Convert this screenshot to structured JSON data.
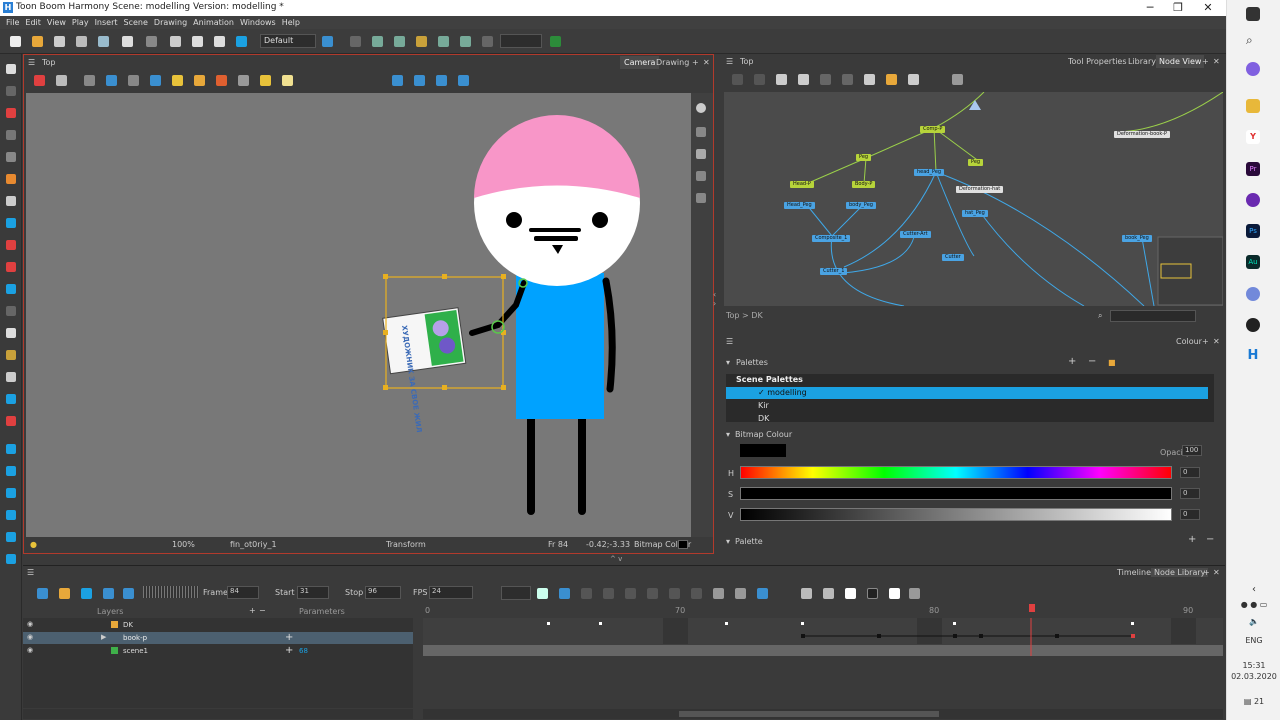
{
  "window": {
    "title": "Toon Boom Harmony Scene: modelling Version: modelling *",
    "minimize": "─",
    "restore": "❐",
    "close": "✕"
  },
  "menu": [
    "File",
    "Edit",
    "View",
    "Play",
    "Insert",
    "Scene",
    "Drawing",
    "Animation",
    "Windows",
    "Help"
  ],
  "toolbar": {
    "workspace_select": "Default"
  },
  "camera_panel": {
    "breadcrumb": "Top",
    "tabs": [
      "Camera",
      "Drawing"
    ],
    "status": {
      "zoom": "100%",
      "drawing_name": "fin_ot0riy_1",
      "tool": "Transform",
      "frame": "Fr 84",
      "coords": "-0.42;-3.33",
      "colour_mode": "Bitmap Colour"
    },
    "poster_text": "ХУДОЖНИК ЗА СВОЕ ЖИЛ"
  },
  "node_panel": {
    "breadcrumb": "Top",
    "tabs": [
      "Tool Properties",
      "Library",
      "Node View"
    ],
    "path": "Top  >  DK",
    "nodes": [
      {
        "label": "Comp-P",
        "kind": "g"
      },
      {
        "label": "Deformation-book-P",
        "kind": "w"
      },
      {
        "label": "Peg",
        "kind": "g"
      },
      {
        "label": "Peg",
        "kind": "g"
      },
      {
        "label": "Head-P",
        "kind": "g"
      },
      {
        "label": "Body-P",
        "kind": "g"
      },
      {
        "label": "head_Peg",
        "kind": "b"
      },
      {
        "label": "Deformation-hat",
        "kind": "w"
      },
      {
        "label": "Head_Peg",
        "kind": "b"
      },
      {
        "label": "body_Peg",
        "kind": "b"
      },
      {
        "label": "hat_Peg",
        "kind": "b"
      },
      {
        "label": "Composite_1",
        "kind": "b"
      },
      {
        "label": "Cutter-Art",
        "kind": "b"
      },
      {
        "label": "Cutter",
        "kind": "b"
      },
      {
        "label": "Cutter_1",
        "kind": "b"
      },
      {
        "label": "book_Peg",
        "kind": "b"
      }
    ]
  },
  "colour_panel": {
    "title": "Colour",
    "palettes_label": "Palettes",
    "scene_palettes_label": "Scene Palettes",
    "palettes": [
      {
        "name": "modelling",
        "selected": true
      },
      {
        "name": "Kir",
        "selected": false
      },
      {
        "name": "DK",
        "selected": false
      }
    ],
    "bitmap_colour_label": "Bitmap Colour",
    "opacity_label": "Opacity",
    "opacity": "100",
    "h_label": "H",
    "h_value": "0",
    "s_label": "S",
    "s_value": "0",
    "v_label": "V",
    "v_value": "0",
    "palette_label": "Palette",
    "current_colour": "#000000"
  },
  "timeline": {
    "tabs": [
      "Timeline",
      "Node Library"
    ],
    "frame_label": "Frame",
    "frame": "84",
    "start_label": "Start",
    "start": "31",
    "stop_label": "Stop",
    "stop": "96",
    "fps_label": "FPS",
    "fps": "24",
    "layers_header": "Layers",
    "params_header": "Parameters",
    "layers": [
      {
        "name": "DK",
        "param": ""
      },
      {
        "name": "book-p",
        "param": ""
      },
      {
        "name": "scene1",
        "param": "68"
      }
    ],
    "ruler_labels": [
      "0",
      "70",
      "80",
      "90"
    ]
  },
  "taskbar": {
    "lang": "ENG",
    "time": "15:31",
    "date": "02.03.2020",
    "notifications": "21"
  },
  "colors": {
    "selection": "#1ba1e2",
    "active_border": "#b23a2c",
    "hat": "#f896c8",
    "body": "#00a2ff"
  }
}
